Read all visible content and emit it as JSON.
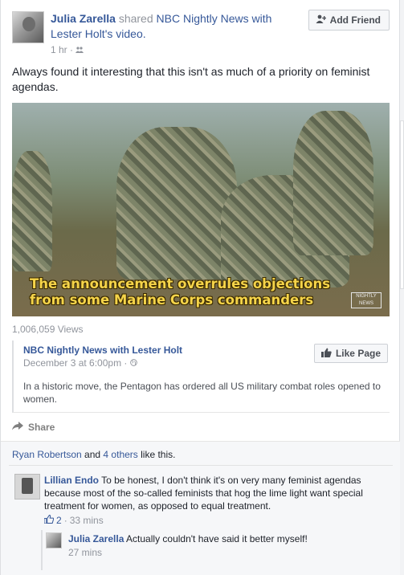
{
  "post": {
    "author": "Julia Zarella",
    "shared_text": " shared ",
    "page_link": "NBC Nightly News with Lester Holt",
    "video_suffix": "'s video.",
    "time": "1 hr",
    "privacy_icon": "friends-icon",
    "add_friend_label": "Add Friend",
    "text": "Always found it interesting that this isn't as much of a priority on feminist agendas."
  },
  "video": {
    "caption_line1": "The announcement overrules objections",
    "caption_line2": "from some Marine Corps commanders",
    "logo_text": "NIGHTLY NEWS",
    "views": "1,006,059 Views"
  },
  "shared_page": {
    "name": "NBC Nightly News with Lester Holt",
    "date": "December 3 at 6:00pm",
    "privacy_icon": "public-globe-icon",
    "like_page_label": "Like Page",
    "description": "In a historic move, the Pentagon has ordered all US military combat roles opened to women."
  },
  "actions": {
    "share_label": "Share"
  },
  "likes": {
    "name": "Ryan Robertson",
    "and": " and ",
    "others": "4 others",
    "suffix": " like this."
  },
  "comment": {
    "author": "Lillian Endo",
    "text": " To be honest, I don't think it's on very many feminist agendas because most of the so-called feminists that hog the lime light want special treatment for women, as opposed to equal treatment.",
    "likes": "2",
    "time": "33 mins"
  },
  "reply": {
    "author": "Julia Zarella",
    "text": " Actually couldn't have said it better myself!",
    "time": "27 mins"
  },
  "colors": {
    "link": "#365899",
    "meta": "#90949c",
    "caption": "#f5d44a"
  }
}
